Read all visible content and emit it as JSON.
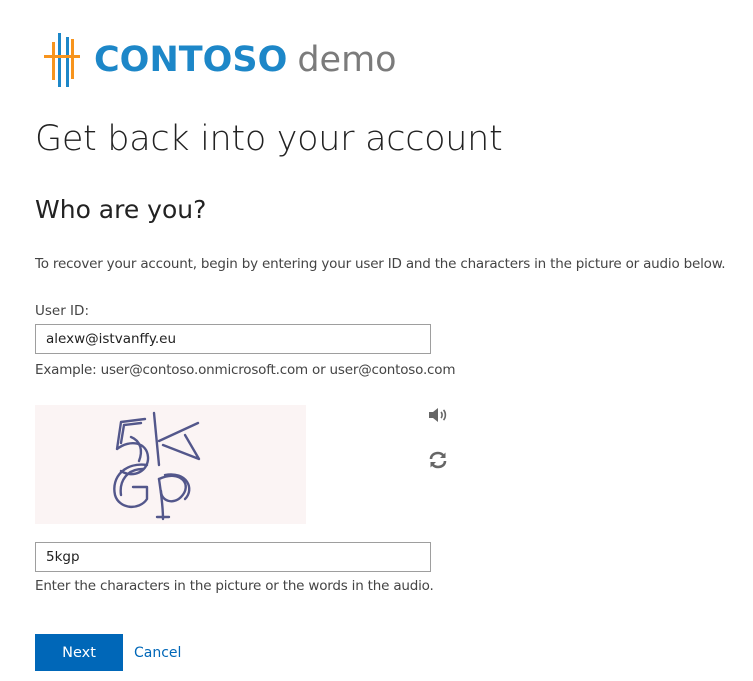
{
  "brand": {
    "name": "CONTOSO",
    "suffix": "demo",
    "color_primary": "#1d87c8",
    "color_accent": "#f7941d",
    "color_suffix": "#7b7b7b"
  },
  "page": {
    "title": "Get back into your account",
    "subtitle": "Who are you?",
    "instructions": "To recover your account, begin by entering your user ID and the characters in the picture or audio below."
  },
  "user_id": {
    "label": "User ID:",
    "value": "alexw@istvanffy.eu",
    "example": "Example: user@contoso.onmicrosoft.com or user@contoso.com"
  },
  "captcha": {
    "image_text": "5kGp",
    "audio_icon": "speaker-icon",
    "refresh_icon": "refresh-icon",
    "value": "5kgp",
    "hint": "Enter the characters in the picture or the words in the audio."
  },
  "actions": {
    "next_label": "Next",
    "cancel_label": "Cancel",
    "button_color": "#0067b8"
  }
}
